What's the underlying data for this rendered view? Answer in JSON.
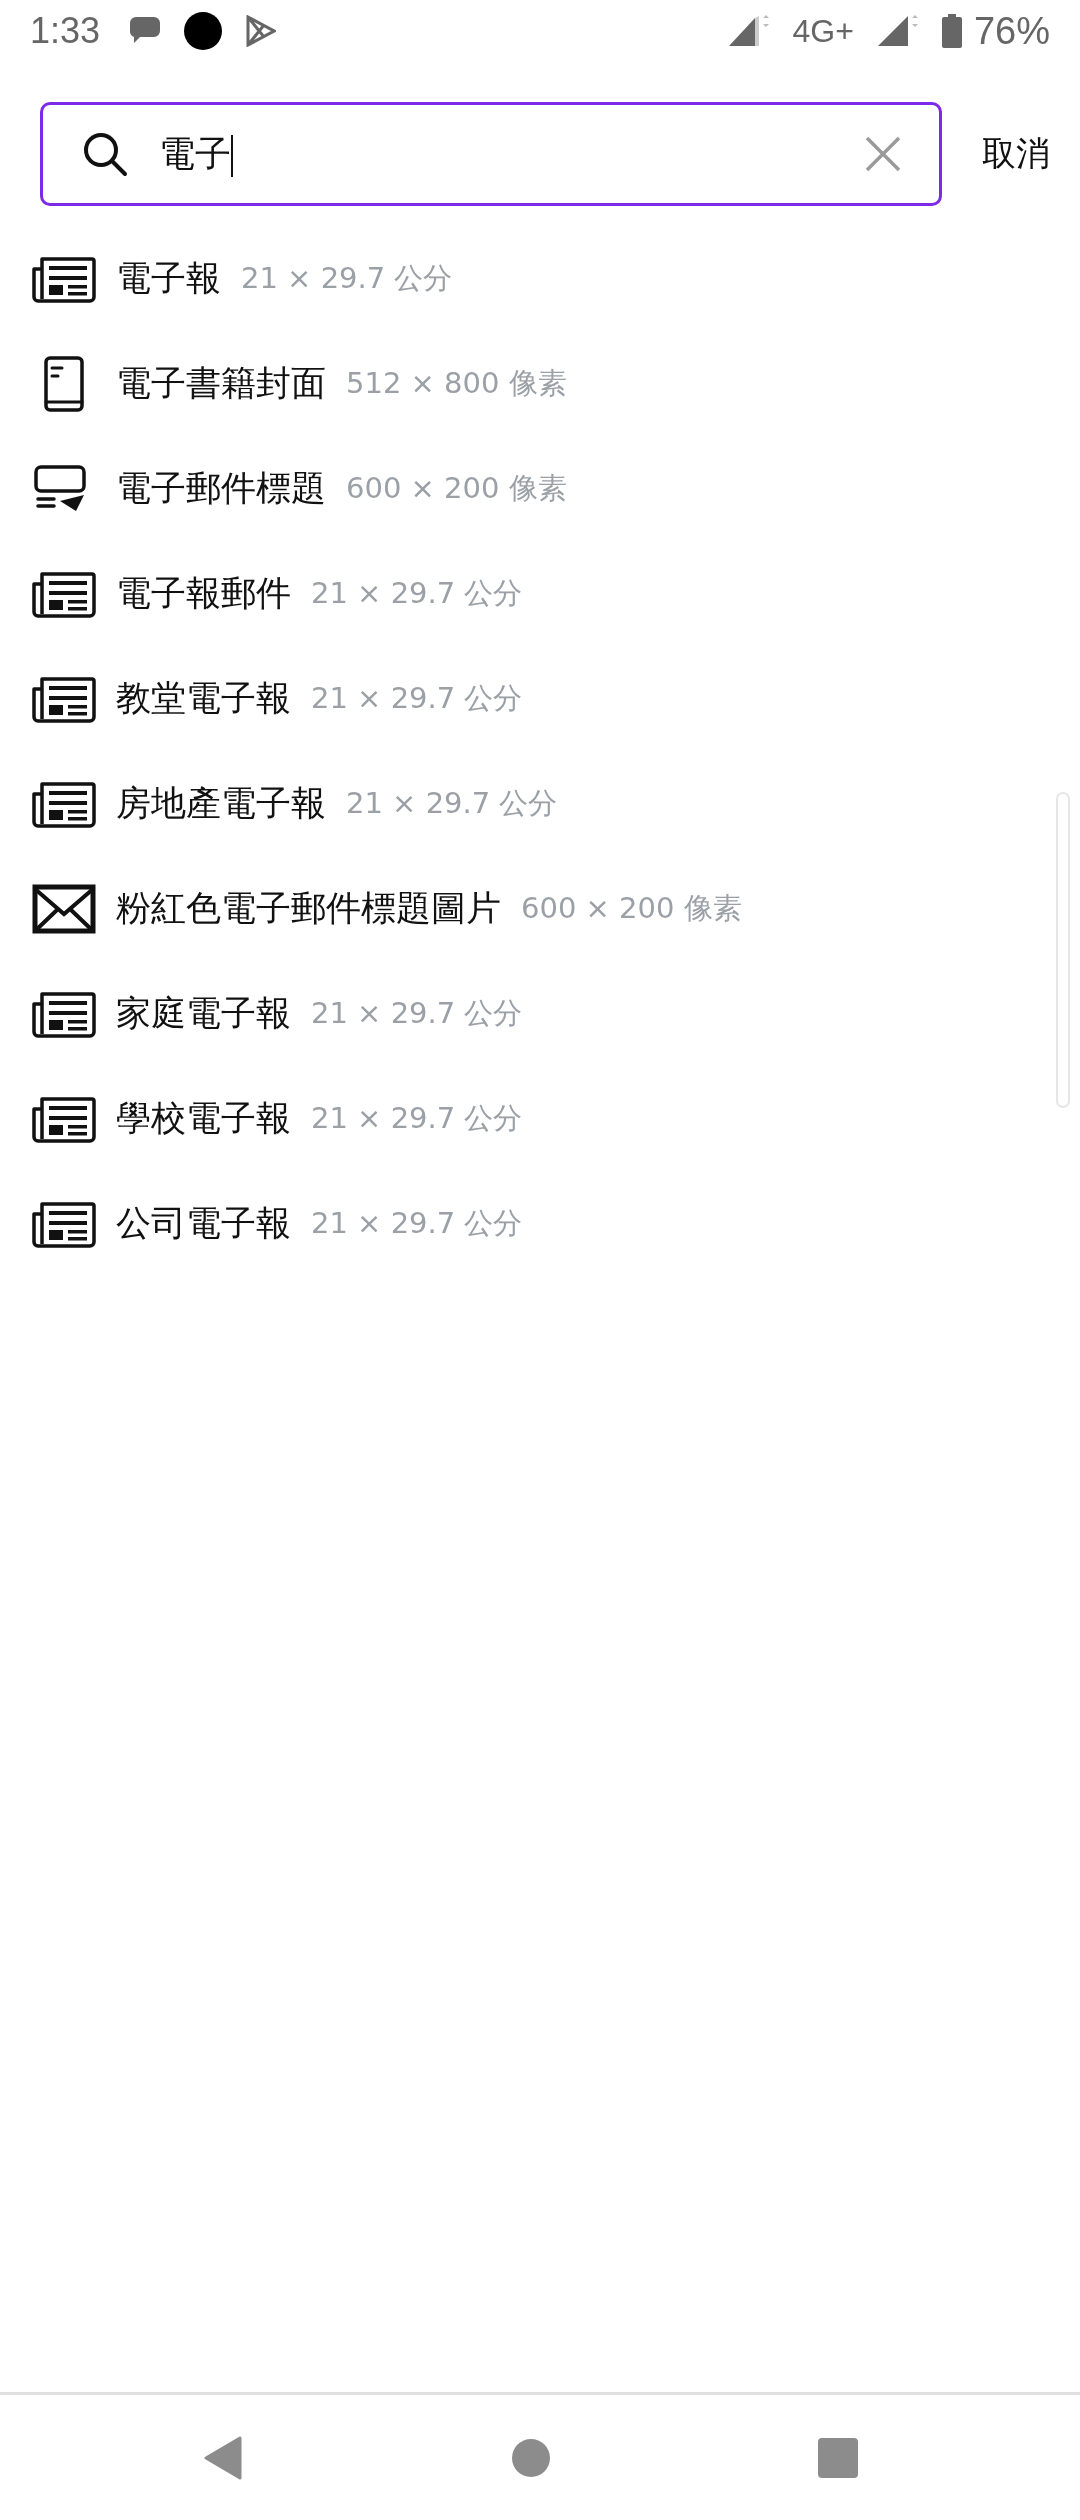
{
  "status_bar": {
    "time": "1:33",
    "network": "4G+",
    "battery": "76%"
  },
  "search": {
    "value": "電子",
    "cancel": "取消"
  },
  "results": [
    {
      "kind": "newsletter",
      "title": "電子報",
      "size": "21 × 29.7 公分"
    },
    {
      "kind": "ebook",
      "title": "電子書籍封面",
      "size": "512 × 800 像素"
    },
    {
      "kind": "email-header",
      "title": "電子郵件標題",
      "size": "600 × 200 像素"
    },
    {
      "kind": "newsletter",
      "title": "電子報郵件",
      "size": "21 × 29.7 公分"
    },
    {
      "kind": "newsletter",
      "title": "教堂電子報",
      "size": "21 × 29.7 公分"
    },
    {
      "kind": "newsletter",
      "title": "房地產電子報",
      "size": "21 × 29.7 公分"
    },
    {
      "kind": "email",
      "title": "粉紅色電子郵件標題圖片",
      "size": "600 × 200 像素"
    },
    {
      "kind": "newsletter",
      "title": "家庭電子報",
      "size": "21 × 29.7 公分"
    },
    {
      "kind": "newsletter",
      "title": "學校電子報",
      "size": "21 × 29.7 公分"
    },
    {
      "kind": "newsletter",
      "title": "公司電子報",
      "size": "21 × 29.7 公分"
    }
  ]
}
